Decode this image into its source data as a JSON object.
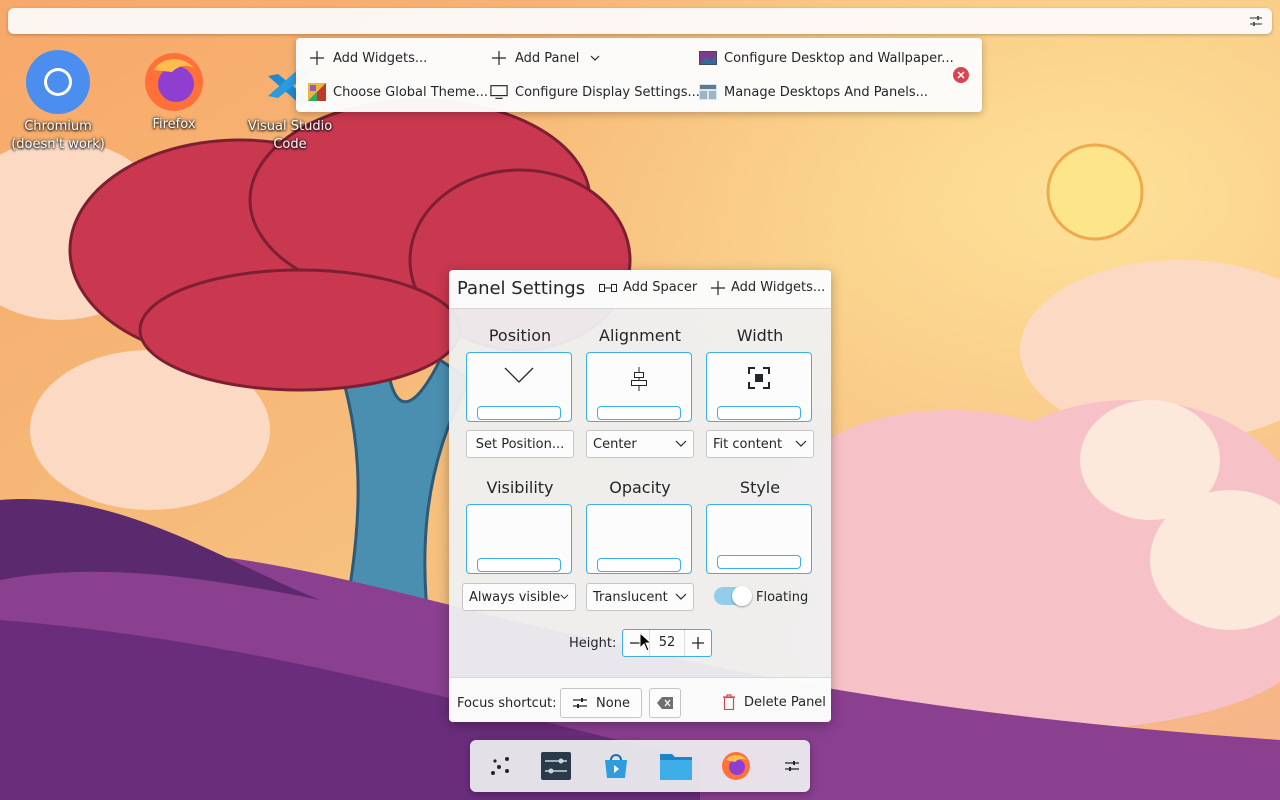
{
  "desktop": {
    "icons": [
      {
        "label": "Chromium\n(doesn't work)",
        "icon": "chromium-icon"
      },
      {
        "label": "Firefox",
        "icon": "firefox-icon"
      },
      {
        "label": "Visual Studio Code",
        "icon": "vscode-icon"
      }
    ]
  },
  "edit_toolbar": {
    "add_widgets": "Add Widgets...",
    "add_panel": "Add Panel",
    "configure_desktop": "Configure Desktop and Wallpaper...",
    "choose_theme": "Choose Global Theme...",
    "configure_display": "Configure Display Settings...",
    "manage_desktops": "Manage Desktops And Panels..."
  },
  "panel_settings": {
    "title": "Panel Settings",
    "add_spacer": "Add Spacer",
    "add_widgets": "Add Widgets...",
    "position": {
      "title": "Position",
      "value": "Set Position..."
    },
    "alignment": {
      "title": "Alignment",
      "value": "Center"
    },
    "width": {
      "title": "Width",
      "value": "Fit content"
    },
    "visibility": {
      "title": "Visibility",
      "value": "Always visible"
    },
    "opacity": {
      "title": "Opacity",
      "value": "Translucent"
    },
    "style": {
      "title": "Style",
      "toggle_label": "Floating",
      "floating": true
    },
    "height": {
      "label": "Height:",
      "value": "52"
    },
    "focus_shortcut": {
      "label": "Focus shortcut:",
      "value": "None"
    },
    "delete_panel": "Delete Panel"
  },
  "dock": {
    "apps": [
      "app-launcher-icon",
      "system-settings-icon",
      "discover-store-icon",
      "file-manager-icon",
      "firefox-icon",
      "panel-configure-icon"
    ]
  },
  "colors": {
    "accent": "#3daee9",
    "close_red": "#da4453"
  }
}
